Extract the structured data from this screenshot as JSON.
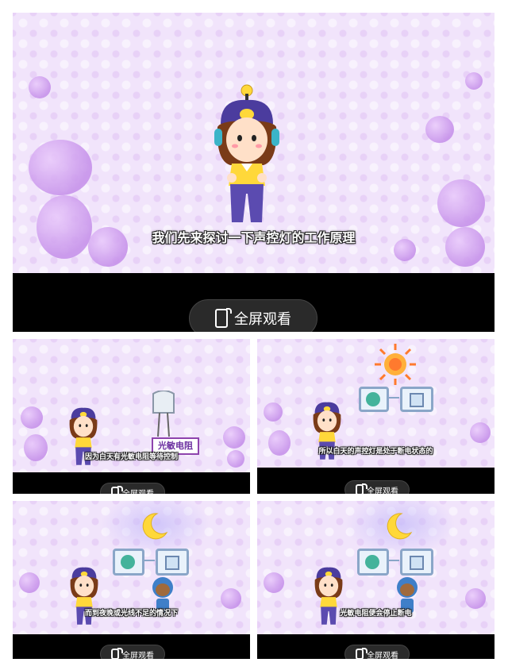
{
  "panels": [
    {
      "subtitle": "我们先来探讨一下声控灯的工作原理",
      "fullscreen_label": "全屏观看"
    },
    {
      "subtitle": "因为白天有光敏电阻等待控制",
      "fullscreen_label": "全屏观看",
      "sign_label": "光敏电阻"
    },
    {
      "subtitle": "所以白天的声控灯是处于断电状态的",
      "fullscreen_label": "全屏观看"
    },
    {
      "subtitle": "而到夜晚或光线不足的情况下",
      "fullscreen_label": "全屏观看"
    },
    {
      "subtitle": "光敏电阻便会停止断电",
      "fullscreen_label": "全屏观看"
    }
  ],
  "icons": {
    "sun": "sun-icon",
    "moon": "moon-icon",
    "phone": "fullscreen-phone-icon"
  },
  "colors": {
    "scene_bg": "#f1e4fb",
    "bar": "#000000",
    "accent": "#8e44ad",
    "moon": "#ffd83a",
    "sun": "#ff7a2e"
  }
}
